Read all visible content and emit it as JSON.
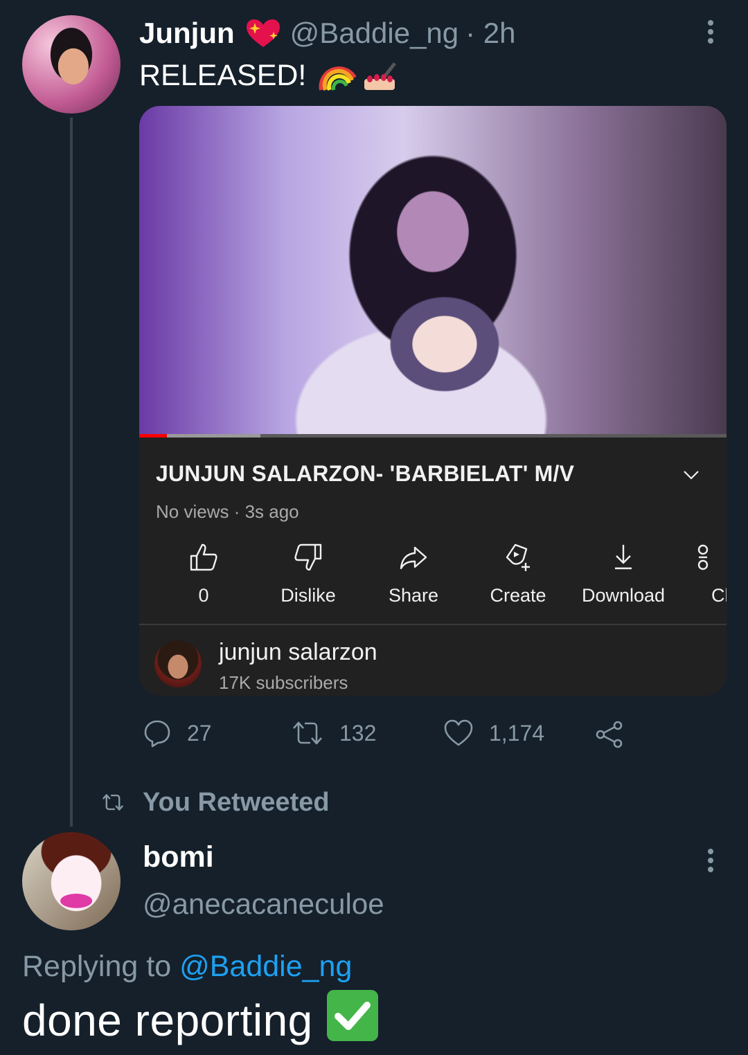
{
  "tweet1": {
    "name": "Junjun",
    "handle": "@Baddie_ng",
    "time": "· 2h",
    "text": "RELEASED!",
    "name_emoji": "heart-sparkle-emoji",
    "text_emojis": [
      "rainbow-emoji",
      "nail-polish-emoji"
    ]
  },
  "video": {
    "title": "JUNJUN SALARZON- 'BARBIELAT' M/V",
    "meta": "No views · 3s ago",
    "actions": [
      {
        "icon": "thumbs-up-icon",
        "label": "0"
      },
      {
        "icon": "thumbs-down-icon",
        "label": "Dislike"
      },
      {
        "icon": "share-arrow-icon",
        "label": "Share"
      },
      {
        "icon": "create-icon",
        "label": "Create"
      },
      {
        "icon": "download-icon",
        "label": "Download"
      },
      {
        "icon": "clip-icon",
        "label": "Cl"
      }
    ],
    "progress": 0.05,
    "channel": {
      "name": "junjun salarzon",
      "subscribers": "17K subscribers"
    }
  },
  "engagement": {
    "replies": "27",
    "retweets": "132",
    "likes": "1,174"
  },
  "retweet_label": "You Retweeted",
  "tweet2": {
    "name": "bomi",
    "handle": "@anecacaneculoe",
    "replying_prefix": "Replying to",
    "replying_handle": "@Baddie_ng",
    "text": "done reporting",
    "text_emoji": "check-mark-emoji"
  },
  "colors": {
    "background": "#15202b",
    "muted": "#8899a6",
    "link": "#1da1f2",
    "youtube_red": "#ff0000",
    "card_bg": "#212121"
  }
}
